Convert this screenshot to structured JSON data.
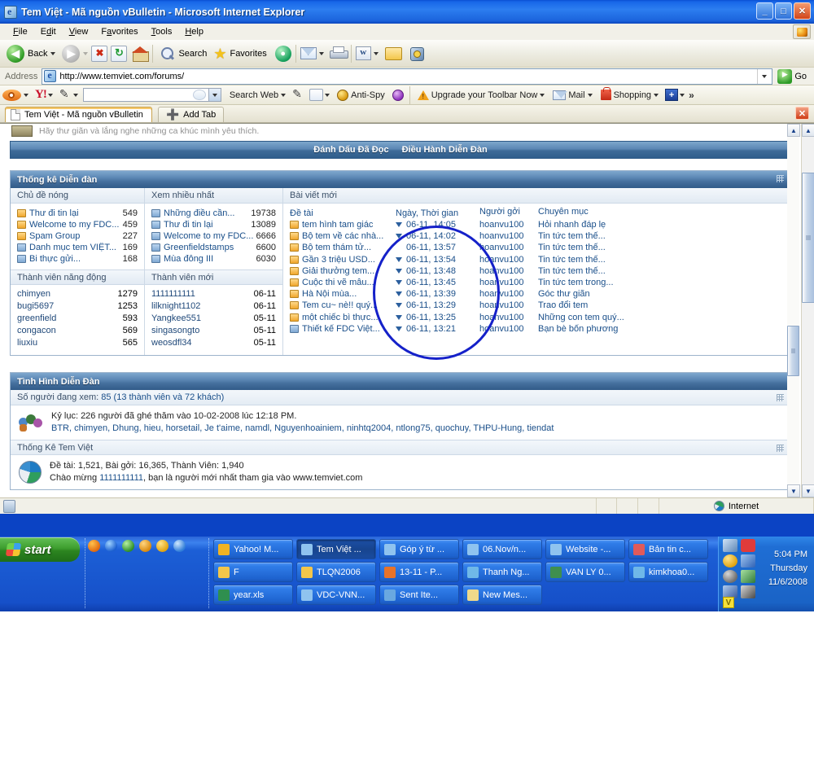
{
  "window": {
    "title": "Tem Việt - Mã nguồn vBulletin - Microsoft Internet Explorer",
    "minimize": "_",
    "maximize": "□",
    "close": "✕",
    "extra_close": "✕"
  },
  "menu": [
    "File",
    "Edit",
    "View",
    "Favorites",
    "Tools",
    "Help"
  ],
  "toolbar": {
    "back": "Back",
    "search": "Search",
    "favorites": "Favorites"
  },
  "address": {
    "label": "Address",
    "url": "http://www.temviet.com/forums/",
    "go": "Go"
  },
  "yahoo_toolbar": {
    "search_value": "",
    "search_web": "Search Web",
    "anti_spy": "Anti-Spy",
    "upgrade": "Upgrade your Toolbar Now",
    "mail": "Mail",
    "shopping": "Shopping",
    "more": "»"
  },
  "tabs": {
    "active": "Tem Việt - Mã nguồn vBulletin",
    "add_tab": "Add Tab",
    "close": "✕"
  },
  "page": {
    "cut_row_text": "Hãy thư giãn và lắng nghe những ca khúc mình yêu thích.",
    "nav_links": [
      "Đánh Dấu Đã Đọc",
      "Điều Hành Diễn Đàn"
    ],
    "forum_stats": {
      "title": "Thống kê Diễn đàn",
      "hot_topics": {
        "header": "Chủ đề nóng",
        "rows": [
          {
            "icon": "orange",
            "name": "Thư đi tin lại",
            "count": "549"
          },
          {
            "icon": "orange",
            "name": "Welcome to my FDC...",
            "count": "459"
          },
          {
            "icon": "orange",
            "name": "Spam Group",
            "count": "227"
          },
          {
            "icon": "blue",
            "name": "Danh mục tem VIỆT...",
            "count": "169"
          },
          {
            "icon": "blue",
            "name": "Bi thực gửi...",
            "count": "168"
          }
        ]
      },
      "most_viewed": {
        "header": "Xem nhiều nhất",
        "rows": [
          {
            "icon": "blue",
            "name": "Những điều cần...",
            "count": "19738"
          },
          {
            "icon": "blue",
            "name": "Thư đi tin lại",
            "count": "13089"
          },
          {
            "icon": "blue",
            "name": "Welcome to my FDC...",
            "count": "6666"
          },
          {
            "icon": "blue",
            "name": "Greenfieldstamps",
            "count": "6600"
          },
          {
            "icon": "blue",
            "name": "Mùa đông III",
            "count": "6030"
          }
        ]
      },
      "active_members": {
        "header": "Thành viên năng động",
        "rows": [
          {
            "name": "chimyen",
            "count": "1279"
          },
          {
            "name": "bugi5697",
            "count": "1253"
          },
          {
            "name": "greenfield",
            "count": "593"
          },
          {
            "name": "congacon",
            "count": "569"
          },
          {
            "name": "liuxiu",
            "count": "565"
          }
        ]
      },
      "new_members": {
        "header": "Thành viên mới",
        "rows": [
          {
            "name": "1111111111",
            "count": "06-11"
          },
          {
            "name": "lilknight1102",
            "count": "06-11"
          },
          {
            "name": "Yangkee551",
            "count": "05-11"
          },
          {
            "name": "singasongto",
            "count": "05-11"
          },
          {
            "name": "weosdfl34",
            "count": "05-11"
          }
        ]
      },
      "new_posts": {
        "header": "Bài viết mới",
        "columns": [
          "Đề tài",
          "Ngày, Thời gian",
          "Người gởi",
          "Chuyên mục"
        ],
        "rows": [
          {
            "icon": "orange",
            "title": "tem hình tam giác",
            "arrow": true,
            "date": "06-11, 14:05",
            "user": "hoanvu100",
            "category": "Hỏi nhanh đáp lẹ"
          },
          {
            "icon": "orange",
            "title": "Bộ tem về các nhà...",
            "arrow": true,
            "date": "06-11, 14:02",
            "user": "hoanvu100",
            "category": "Tin tức tem thế..."
          },
          {
            "icon": "orange",
            "title": "Bộ tem thám tử...",
            "arrow": false,
            "date": "06-11, 13:57",
            "user": "hoanvu100",
            "category": "Tin tức tem thế..."
          },
          {
            "icon": "orange",
            "title": "Gần 3 triệu USD...",
            "arrow": true,
            "date": "06-11, 13:54",
            "user": "hoanvu100",
            "category": "Tin tức tem thế..."
          },
          {
            "icon": "orange",
            "title": "Giải thưởng tem...",
            "arrow": true,
            "date": "06-11, 13:48",
            "user": "hoanvu100",
            "category": "Tin tức tem thế..."
          },
          {
            "icon": "orange",
            "title": "Cuộc thi vẽ mẫu...",
            "arrow": true,
            "date": "06-11, 13:45",
            "user": "hoanvu100",
            "category": "Tin tức tem trong..."
          },
          {
            "icon": "orange",
            "title": "Hà Nội mùa...",
            "arrow": true,
            "date": "06-11, 13:39",
            "user": "hoanvu100",
            "category": "Góc thư giãn"
          },
          {
            "icon": "orange",
            "title": "Tem cu~ nè!! quý...",
            "arrow": true,
            "date": "06-11, 13:29",
            "user": "hoanvu100",
            "category": "Trao đổi tem"
          },
          {
            "icon": "orange",
            "title": "một chiếc bì thực...",
            "arrow": true,
            "date": "06-11, 13:25",
            "user": "hoanvu100",
            "category": "Những con tem quý..."
          },
          {
            "icon": "blue",
            "title": "Thiết kế FDC Việt...",
            "arrow": true,
            "date": "06-11, 13:21",
            "user": "hoanvu100",
            "category": "Bạn bè bốn phương"
          }
        ]
      }
    },
    "forum_status": {
      "title": "Tình Hình Diễn Đàn",
      "viewers_label": "Số người đang xem:",
      "viewers_value": "85 (13 thành viên và 72 khách)",
      "record_line": "Kỷ lục: 226 người đã ghé thăm vào 10-02-2008 lúc 12:18 PM.",
      "members_line": "BTR, chimyen, Dhung, hieu, horsetail, Je t'aime, namdl, Nguyenhoainiem, ninhtq2004, ntlong75, quochuy, THPU-Hung, tiendat",
      "stats_header": "Thống Kê Tem Việt",
      "stats_line": "Đề tài: 1,521, Bài gởi: 16,365, Thành Viên: 1,940",
      "welcome_prefix": "Chào mừng",
      "welcome_user": "1111111111",
      "welcome_suffix": ", bạn là người mới nhất tham gia vào www.temviet.com"
    }
  },
  "statusbar": {
    "zone": "Internet"
  },
  "taskbar": {
    "start": "start",
    "tasks": [
      {
        "label": "Yahoo! M...",
        "color": "#f0b323",
        "active": false
      },
      {
        "label": "Tem Việt ...",
        "color": "#8fc3ef",
        "active": true
      },
      {
        "label": "Góp ý từ ...",
        "color": "#8fc3ef",
        "active": false
      },
      {
        "label": "06.Nov/n...",
        "color": "#8fc3ef",
        "active": false
      },
      {
        "label": "Website -...",
        "color": "#8fc3ef",
        "active": false
      },
      {
        "label": "Bản tin c...",
        "color": "#e05a5a",
        "active": false
      },
      {
        "label": "F",
        "color": "#f3c64a",
        "active": false
      },
      {
        "label": "TLQN2006",
        "color": "#f3c64a",
        "active": false
      },
      {
        "label": "13-11 - P...",
        "color": "#e8732a",
        "active": false
      },
      {
        "label": "Thanh Ng...",
        "color": "#6fb8e8",
        "active": false
      },
      {
        "label": "VAN LY 0...",
        "color": "#3f8f4f",
        "active": false
      },
      {
        "label": "kimkhoa0...",
        "color": "#6fb8e8",
        "active": false
      },
      {
        "label": "year.xls",
        "color": "#2f8f4f",
        "active": false
      },
      {
        "label": "VDC-VNN...",
        "color": "#8fc3ef",
        "active": false
      },
      {
        "label": "Sent Ite...",
        "color": "#69a8e0",
        "active": false
      },
      {
        "label": "New Mes...",
        "color": "#f0d98a",
        "active": false
      }
    ],
    "clock": {
      "time": "5:04 PM",
      "day": "Thursday",
      "date": "11/6/2008"
    },
    "tray_badge": "V"
  },
  "colors": {
    "accent_blue": "#3b6894",
    "link_blue": "#1a4f8a",
    "annotation": "#1521c9",
    "taskbar": "#1b5fd0"
  }
}
